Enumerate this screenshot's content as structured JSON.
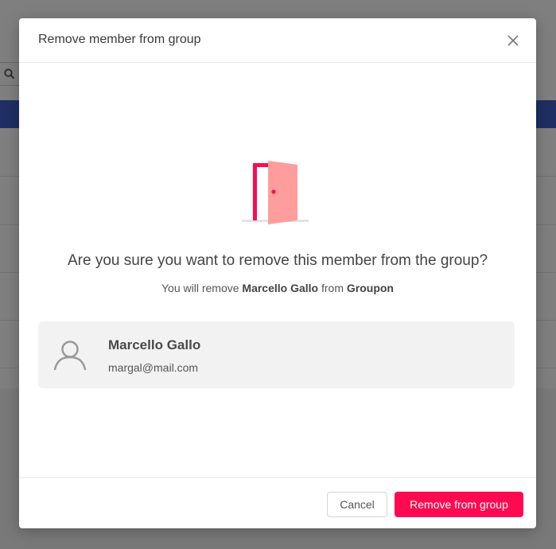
{
  "modal": {
    "title": "Remove member from group",
    "question": "Are you sure you want to remove this member from the group?",
    "sub_prefix": "You will remove",
    "sub_member": "Marcello Gallo",
    "sub_mid": "from",
    "sub_group": "Groupon",
    "member": {
      "name": "Marcello Gallo",
      "email": "margal@mail.com"
    },
    "buttons": {
      "cancel": "Cancel",
      "remove": "Remove from group"
    }
  },
  "icons": {
    "close": "close-icon",
    "door": "door-exit-illustration",
    "avatar": "user-avatar-icon",
    "search": "search-icon"
  },
  "colors": {
    "accent": "#ff0a50",
    "door_frame": "#ff0a50",
    "door_panel": "#ff9d9d",
    "header_bar": "#3f5cc8"
  }
}
